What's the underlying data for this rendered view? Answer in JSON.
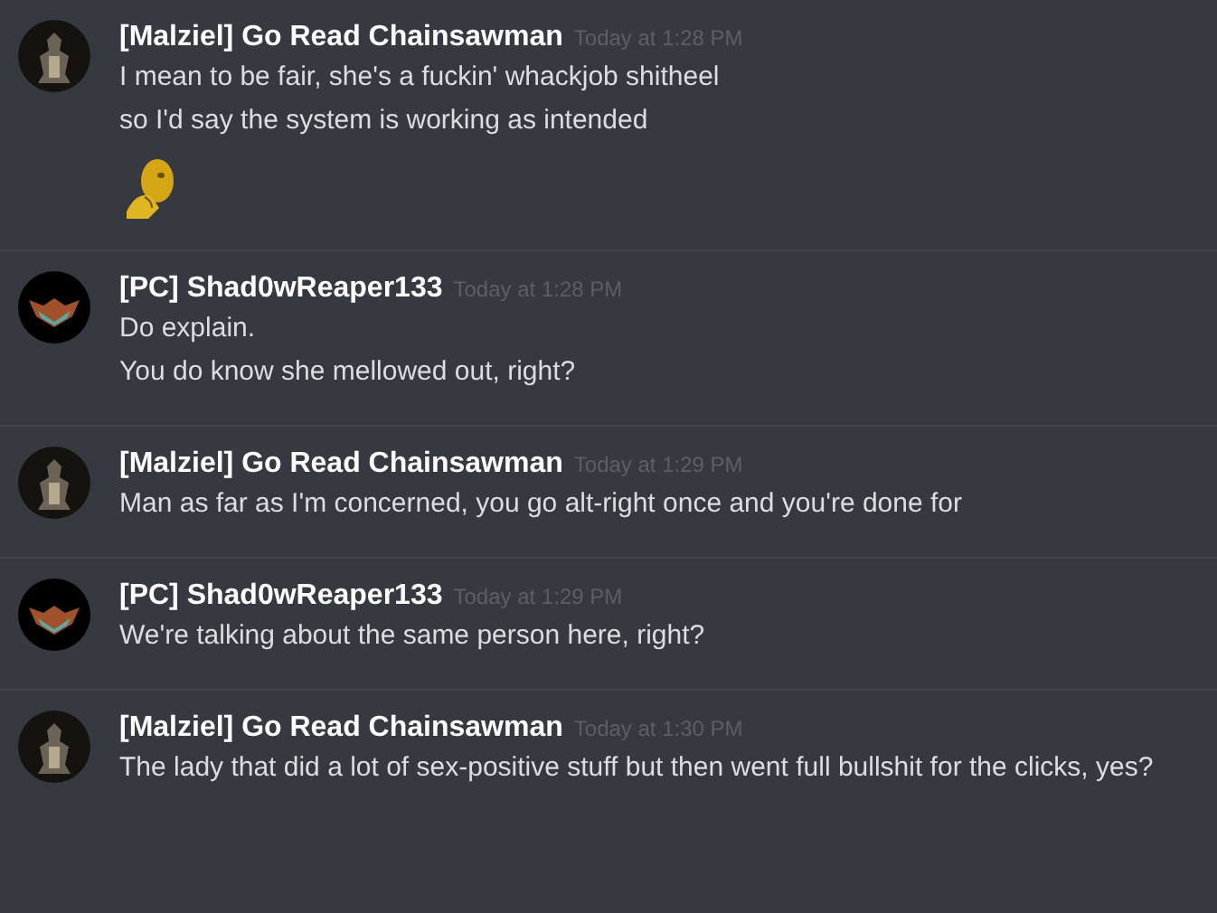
{
  "messages": [
    {
      "author": "[Malziel] Go Read Chainsawman",
      "avatar": {
        "kind": "armored-figure"
      },
      "timestamp": "Today at 1:28 PM",
      "lines": [
        "I mean to be fair, she's a fuckin' whackjob shitheel",
        "so I'd say the system is working as intended"
      ],
      "emoji": true
    },
    {
      "author": "[PC] Shad0wReaper133",
      "avatar": {
        "kind": "winged-emblem"
      },
      "timestamp": "Today at 1:28 PM",
      "lines": [
        "Do explain.",
        "You do know she mellowed out, right?"
      ],
      "emoji": false
    },
    {
      "author": "[Malziel] Go Read Chainsawman",
      "avatar": {
        "kind": "armored-figure"
      },
      "timestamp": "Today at 1:29 PM",
      "lines": [
        "Man as far as I'm concerned, you go alt-right once and you're done for"
      ],
      "emoji": false
    },
    {
      "author": "[PC] Shad0wReaper133",
      "avatar": {
        "kind": "winged-emblem"
      },
      "timestamp": "Today at 1:29 PM",
      "lines": [
        "We're talking about the same person here, right?"
      ],
      "emoji": false
    },
    {
      "author": "[Malziel] Go Read Chainsawman",
      "avatar": {
        "kind": "armored-figure"
      },
      "timestamp": "Today at 1:30 PM",
      "lines": [
        "The lady that did a lot of sex-positive stuff but then went full bullshit for the clicks, yes?"
      ],
      "emoji": false
    }
  ]
}
